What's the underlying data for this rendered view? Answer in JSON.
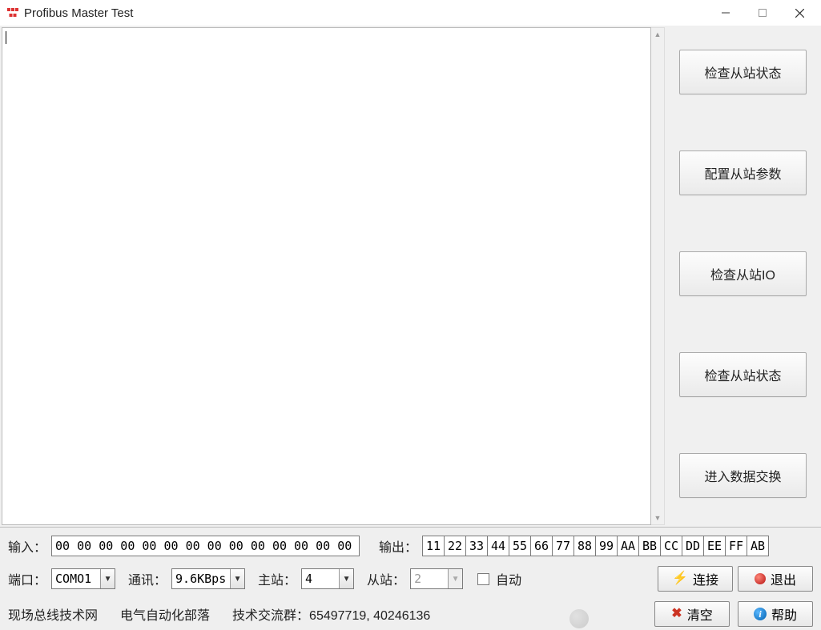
{
  "window": {
    "title": "Profibus Master Test",
    "icon_label": "app-icon"
  },
  "side_buttons": [
    "检查从站状态",
    "配置从站参数",
    "检查从站IO",
    "检查从站状态",
    "进入数据交换"
  ],
  "io": {
    "input_label": "输入：",
    "input_value": "00 00 00 00 00 00 00 00 00 00 00 00 00 00 00 00",
    "output_label": "输出：",
    "output_cells": [
      "11",
      "22",
      "33",
      "44",
      "55",
      "66",
      "77",
      "88",
      "99",
      "AA",
      "BB",
      "CC",
      "DD",
      "EE",
      "FF",
      "AB"
    ]
  },
  "settings": {
    "port_label": "端口：",
    "port_value": "COMO1",
    "baud_label": "通讯：",
    "baud_value": "9.6KBps",
    "master_label": "主站：",
    "master_value": "4",
    "slave_label": "从站：",
    "slave_value": "2",
    "auto_label": "自动"
  },
  "actions": {
    "connect": "连接",
    "exit": "退出",
    "clear": "清空",
    "help": "帮助"
  },
  "footer": {
    "site": "现场总线技术网",
    "group": "电气自动化部落",
    "qq_label": "技术交流群：",
    "qq_numbers": "65497719, 40246136"
  }
}
